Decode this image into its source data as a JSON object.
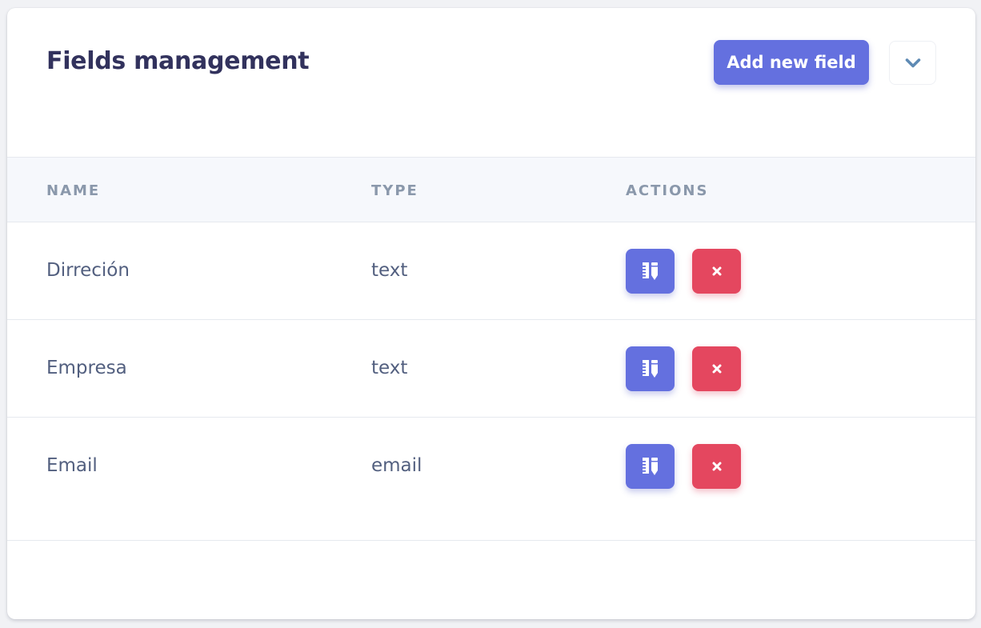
{
  "header": {
    "title": "Fields management",
    "add_button_label": "Add new field"
  },
  "table": {
    "columns": [
      "NAME",
      "TYPE",
      "ACTIONS"
    ],
    "rows": [
      {
        "name": "Dirreción",
        "type": "text"
      },
      {
        "name": "Empresa",
        "type": "text"
      },
      {
        "name": "Email",
        "type": "email"
      }
    ]
  },
  "icons": {
    "toggle": "chevron-down-icon",
    "edit": "edit-icon",
    "delete": "close-icon"
  },
  "colors": {
    "primary": "#6470df",
    "danger": "#e4475f",
    "title": "#32325d",
    "header_text": "#8a98ab",
    "body_text": "#525f7f",
    "chevron": "#5e8ab4"
  }
}
